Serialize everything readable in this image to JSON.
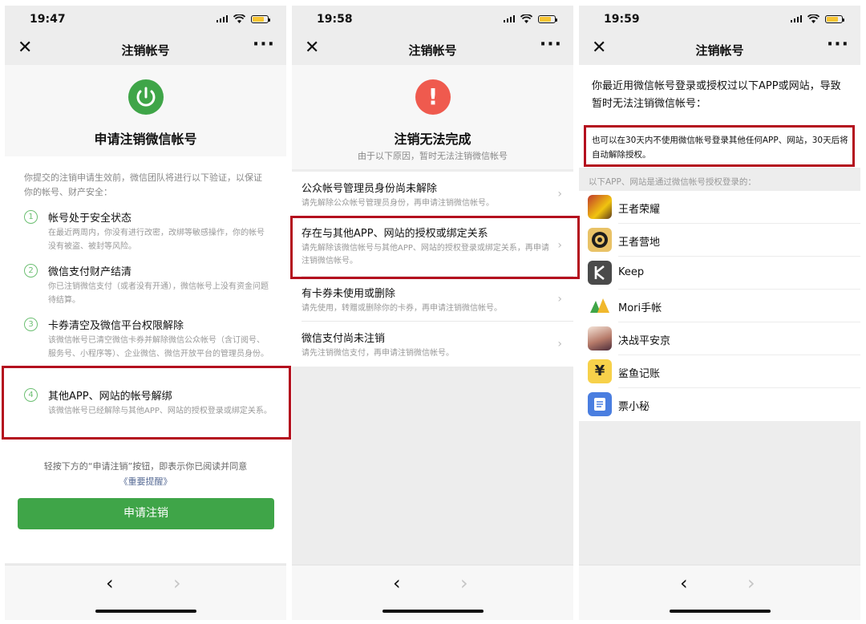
{
  "colors": {
    "accent_green": "#3fa548",
    "warning_red": "#ef5a4e",
    "highlight_red": "#b40f1e",
    "link_blue": "#576b95",
    "battery": "#f6c431"
  },
  "panels": [
    {
      "time": "19:47",
      "title": "注销帐号",
      "close": "✕",
      "more": "···"
    },
    {
      "time": "19:58",
      "title": "注销帐号",
      "close": "✕",
      "more": "···"
    },
    {
      "time": "19:59",
      "title": "注销帐号",
      "close": "✕",
      "more": "···"
    }
  ],
  "nav": {
    "back": "‹",
    "forward": "›"
  },
  "p1": {
    "heading": "申请注销微信帐号",
    "intro": "你提交的注销申请生效前，微信团队将进行以下验证，以保证你的帐号、财产安全：",
    "steps": [
      {
        "num": "1",
        "title": "帐号处于安全状态",
        "desc": "在最近两周内，你没有进行改密，改绑等敏感操作，你的帐号没有被盗、被封等风险。"
      },
      {
        "num": "2",
        "title": "微信支付财产结清",
        "desc": "你已注销微信支付（或者没有开通），微信帐号上没有资金问题待结算。"
      },
      {
        "num": "3",
        "title": "卡券清空及微信平台权限解除",
        "desc": "该微信帐号已清空微信卡券并解除微信公众帐号（含订阅号、服务号、小程序等）、企业微信、微信开放平台的管理员身份。"
      },
      {
        "num": "4",
        "title": "其他APP、网站的帐号解绑",
        "desc": "该微信帐号已经解除与其他APP、网站的授权登录或绑定关系。"
      }
    ],
    "agree": "轻按下方的“申请注销”按钮，即表示你已阅读并同意",
    "agree_link": "《重要提醒》",
    "button": "申请注销"
  },
  "p2": {
    "heading": "注销无法完成",
    "sub": "由于以下原因，暂时无法注销微信帐号",
    "reasons": [
      {
        "title": "公众帐号管理员身份尚未解除",
        "desc": "请先解除公众帐号管理员身份，再申请注销微信帐号。"
      },
      {
        "title": "存在与其他APP、网站的授权或绑定关系",
        "desc": "请先解除该微信帐号与其他APP、网站的授权登录或绑定关系，再申请注销微信帐号。"
      },
      {
        "title": "有卡券未使用或删除",
        "desc": "请先使用，转赠或删除你的卡券，再申请注销微信帐号。"
      },
      {
        "title": "微信支付尚未注销",
        "desc": "请先注销微信支付，再申请注销微信帐号。"
      }
    ]
  },
  "p3": {
    "heading": "你最近用微信帐号登录或授权过以下APP或网站，导致暂时无法注销微信帐号：",
    "notice": "也可以在30天内不使用微信帐号登录其他任何APP、网站，30天后将自动解除授权。",
    "list_hint": "以下APP、网站是通过微信帐号授权登录的：",
    "apps": [
      {
        "name": "王者荣耀",
        "icon": "honor-of-kings-icon"
      },
      {
        "name": "王者营地",
        "icon": "king-camp-icon"
      },
      {
        "name": "Keep",
        "icon": "keep-icon"
      },
      {
        "name": "Mori手帐",
        "icon": "mori-icon"
      },
      {
        "name": "决战平安京",
        "icon": "onmyoji-arena-icon"
      },
      {
        "name": "鲨鱼记账",
        "icon": "shark-bookkeeping-icon",
        "glyph": "¥"
      },
      {
        "name": "票小秘",
        "icon": "ticket-icon"
      }
    ]
  }
}
